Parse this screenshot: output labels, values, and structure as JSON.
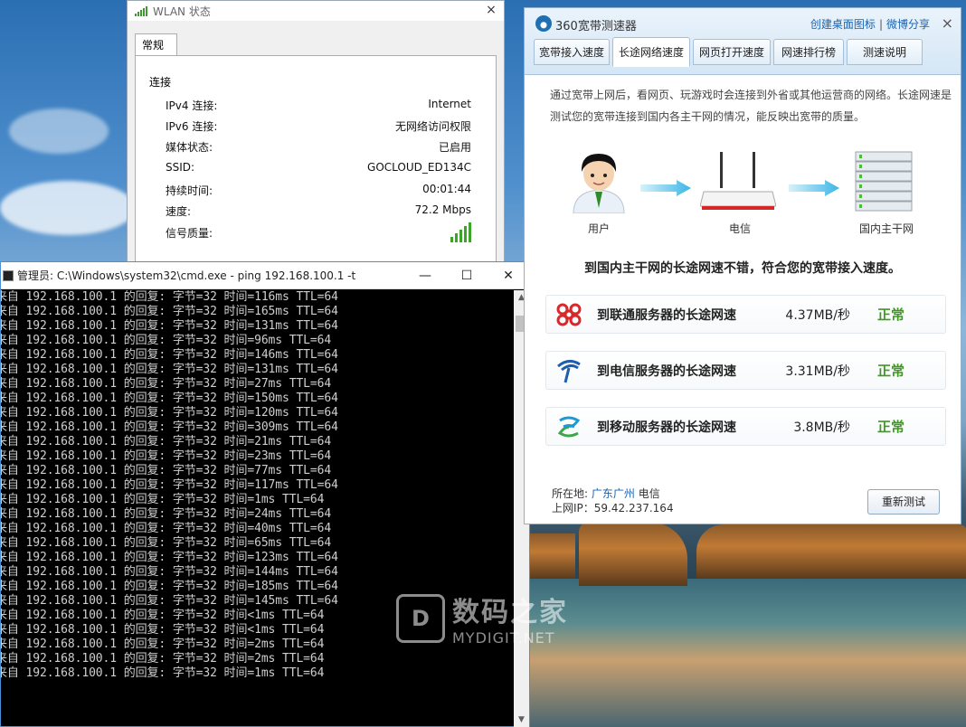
{
  "wlan": {
    "title": "WLAN 状态",
    "tab": "常规",
    "section": "连接",
    "rows": [
      {
        "label": "IPv4 连接:",
        "value": "Internet"
      },
      {
        "label": "IPv6 连接:",
        "value": "无网络访问权限"
      },
      {
        "label": "媒体状态:",
        "value": "已启用"
      },
      {
        "label": "SSID:",
        "value": "GOCLOUD_ED134C"
      },
      {
        "label": "持续时间:",
        "value": "00:01:44"
      },
      {
        "label": "速度:",
        "value": "72.2 Mbps"
      }
    ],
    "quality_label": "信号质量:",
    "signal_bars": 5,
    "close_icon": "×"
  },
  "cmd": {
    "title": "管理员: C:\\Windows\\system32\\cmd.exe - ping  192.168.100.1 -t",
    "minimize": "—",
    "maximize": "☐",
    "close": "✕",
    "lines": [
      "来自 192.168.100.1 的回复: 字节=32 时间=116ms TTL=64",
      "来自 192.168.100.1 的回复: 字节=32 时间=165ms TTL=64",
      "来自 192.168.100.1 的回复: 字节=32 时间=131ms TTL=64",
      "来自 192.168.100.1 的回复: 字节=32 时间=96ms TTL=64",
      "来自 192.168.100.1 的回复: 字节=32 时间=146ms TTL=64",
      "来自 192.168.100.1 的回复: 字节=32 时间=131ms TTL=64",
      "来自 192.168.100.1 的回复: 字节=32 时间=27ms TTL=64",
      "来自 192.168.100.1 的回复: 字节=32 时间=150ms TTL=64",
      "来自 192.168.100.1 的回复: 字节=32 时间=120ms TTL=64",
      "来自 192.168.100.1 的回复: 字节=32 时间=309ms TTL=64",
      "来自 192.168.100.1 的回复: 字节=32 时间=21ms TTL=64",
      "来自 192.168.100.1 的回复: 字节=32 时间=23ms TTL=64",
      "来自 192.168.100.1 的回复: 字节=32 时间=77ms TTL=64",
      "来自 192.168.100.1 的回复: 字节=32 时间=117ms TTL=64",
      "来自 192.168.100.1 的回复: 字节=32 时间=1ms TTL=64",
      "来自 192.168.100.1 的回复: 字节=32 时间=24ms TTL=64",
      "来自 192.168.100.1 的回复: 字节=32 时间=40ms TTL=64",
      "来自 192.168.100.1 的回复: 字节=32 时间=65ms TTL=64",
      "来自 192.168.100.1 的回复: 字节=32 时间=123ms TTL=64",
      "来自 192.168.100.1 的回复: 字节=32 时间=144ms TTL=64",
      "来自 192.168.100.1 的回复: 字节=32 时间=185ms TTL=64",
      "来自 192.168.100.1 的回复: 字节=32 时间=145ms TTL=64",
      "来自 192.168.100.1 的回复: 字节=32 时间<1ms TTL=64",
      "来自 192.168.100.1 的回复: 字节=32 时间<1ms TTL=64",
      "来自 192.168.100.1 的回复: 字节=32 时间=2ms TTL=64",
      "来自 192.168.100.1 的回复: 字节=32 时间=2ms TTL=64",
      "来自 192.168.100.1 的回复: 字节=32 时间=1ms TTL=64"
    ]
  },
  "speed": {
    "title": "360宽带测速器",
    "link_desktop": "创建桌面图标",
    "link_weibo": "微博分享",
    "separator": "|",
    "close": "×",
    "tabs": [
      "宽带接入速度",
      "长途网络速度",
      "网页打开速度",
      "网速排行榜",
      "测速说明"
    ],
    "active_tab": 1,
    "description": "通过宽带上网后，看网页、玩游戏时会连接到外省或其他运营商的网络。长途网速是测试您的宽带连接到国内各主干网的情况，能反映出宽带的质量。",
    "diagram": {
      "user": "用户",
      "telecom": "电信",
      "backbone": "国内主干网"
    },
    "summary": "到国内主干网的长途网速不错，符合您的宽带接入速度。",
    "results": [
      {
        "label": "到联通服务器的长途网速",
        "value": "4.37MB/秒",
        "status": "正常",
        "icon": "unicom-icon",
        "color": "#d8282a"
      },
      {
        "label": "到电信服务器的长途网速",
        "value": "3.31MB/秒",
        "status": "正常",
        "icon": "telecom-icon",
        "color": "#1d5fae"
      },
      {
        "label": "到移动服务器的长途网速",
        "value": "3.8MB/秒",
        "status": "正常",
        "icon": "mobile-icon",
        "color": "#1a9ad6"
      }
    ],
    "location_label": "所在地:",
    "location_city": "广东广州",
    "location_isp": "电信",
    "ip_label": "上网IP：",
    "ip": "59.42.237.164",
    "retest": "重新测试"
  },
  "watermark": {
    "big": "数码之家",
    "small": "MYDIGIT.NET",
    "logo": "D"
  }
}
